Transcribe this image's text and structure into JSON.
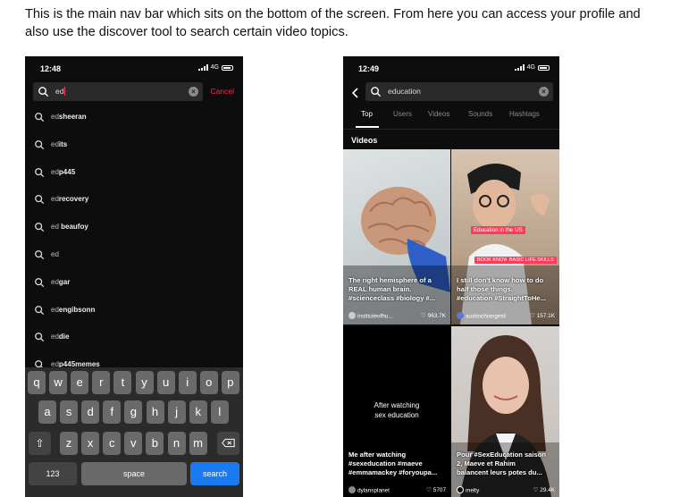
{
  "caption": {
    "line1": "This is the main nav bar which sits on the bottom of the screen. From here you can access your profile and",
    "line2": "also use the discover tool to search certain video topics."
  },
  "phone_left": {
    "status": {
      "time": "12:48",
      "network": "4G"
    },
    "search": {
      "value": "ed",
      "cancel_label": "Cancel"
    },
    "suggestions": [
      {
        "prefix": "ed",
        "rest": "sheeran"
      },
      {
        "prefix": "ed",
        "rest": "its"
      },
      {
        "prefix": "ed",
        "rest": "p445"
      },
      {
        "prefix": "ed",
        "rest": "recovery"
      },
      {
        "prefix": "ed",
        "rest": " beaufoy"
      },
      {
        "prefix": "ed",
        "rest": ""
      },
      {
        "prefix": "ed",
        "rest": "gar"
      },
      {
        "prefix": "ed",
        "rest": "engibsonn"
      },
      {
        "prefix": "ed",
        "rest": "die"
      },
      {
        "prefix": "ed",
        "rest": "p445memes"
      }
    ],
    "keyboard": {
      "row1": [
        "q",
        "w",
        "e",
        "r",
        "t",
        "y",
        "u",
        "i",
        "o",
        "p"
      ],
      "row2": [
        "a",
        "s",
        "d",
        "f",
        "g",
        "h",
        "j",
        "k",
        "l"
      ],
      "row3": [
        "z",
        "x",
        "c",
        "v",
        "b",
        "n",
        "m"
      ],
      "numbers_label": "123",
      "space_label": "space",
      "search_label": "search"
    }
  },
  "phone_right": {
    "status": {
      "time": "12:49",
      "network": "4G"
    },
    "search": {
      "value": "education"
    },
    "tabs": [
      "Top",
      "Users",
      "Videos",
      "Sounds",
      "Hashtags"
    ],
    "section_title": "Videos",
    "videos": [
      {
        "caption": [
          "The right hemisphere of a",
          "REAL human brain.",
          "#scienceclass #biology #..."
        ],
        "user": "instituteofhu...",
        "likes": "963.7K"
      },
      {
        "caption": [
          "I still don't know how to do",
          "half those things.",
          "#education #StraightToHe..."
        ],
        "user": "austinchiangmd",
        "likes": "157.1K",
        "overlay": "Education in the US",
        "tags": [
          "BOOK KNOWLEDGE",
          "BASIC LIFE SKILLS"
        ]
      },
      {
        "caption": [
          "Me after watching",
          "#sexeducation #maeve",
          "#emmamackey #foryoupa..."
        ],
        "user": "dylansplanet",
        "likes": "5707",
        "center_text": [
          "After watching",
          "sex education"
        ]
      },
      {
        "caption": [
          "Pour #SexEducation saison",
          "2, Maeve et Rahim",
          "balancent leurs potes du..."
        ],
        "user": "melty",
        "likes": "29.4K"
      }
    ]
  },
  "colors": {
    "accent": "#fe2c55",
    "keyboard_return": "#1a7bf0",
    "bg": "#0d0d0d"
  },
  "icons": [
    "search-icon",
    "clear-icon",
    "back-icon",
    "heart-icon",
    "shift-icon",
    "backspace-icon",
    "signal-icon",
    "battery-icon"
  ]
}
